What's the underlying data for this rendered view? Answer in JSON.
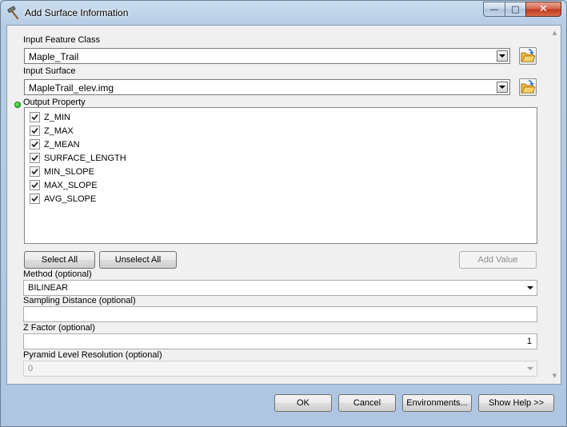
{
  "window": {
    "title": "Add Surface Information",
    "title_icon": "hammer-icon",
    "minimize_glyph": "—",
    "maximize_glyph": "□",
    "close_glyph": "✕"
  },
  "input_feature_class": {
    "label": "Input Feature Class",
    "value": "Maple_Trail",
    "browse_icon": "folder-open-icon"
  },
  "input_surface": {
    "label": "Input Surface",
    "value": "MapleTrail_elev.img",
    "browse_icon": "folder-open-icon"
  },
  "output_property": {
    "label": "Output Property",
    "items": [
      {
        "label": "Z_MIN",
        "checked": true
      },
      {
        "label": "Z_MAX",
        "checked": true
      },
      {
        "label": "Z_MEAN",
        "checked": true
      },
      {
        "label": "SURFACE_LENGTH",
        "checked": true
      },
      {
        "label": "MIN_SLOPE",
        "checked": true
      },
      {
        "label": "MAX_SLOPE",
        "checked": true
      },
      {
        "label": "AVG_SLOPE",
        "checked": true
      }
    ],
    "select_all": "Select All",
    "unselect_all": "Unselect All",
    "add_value": "Add Value"
  },
  "method": {
    "label": "Method (optional)",
    "value": "BILINEAR"
  },
  "sampling_distance": {
    "label": "Sampling Distance (optional)",
    "value": ""
  },
  "z_factor": {
    "label": "Z Factor (optional)",
    "value": "1"
  },
  "pyramid_level": {
    "label": "Pyramid Level Resolution (optional)",
    "value": "0"
  },
  "footer": {
    "ok": "OK",
    "cancel": "Cancel",
    "environments": "Environments...",
    "show_help": "Show Help >>"
  }
}
